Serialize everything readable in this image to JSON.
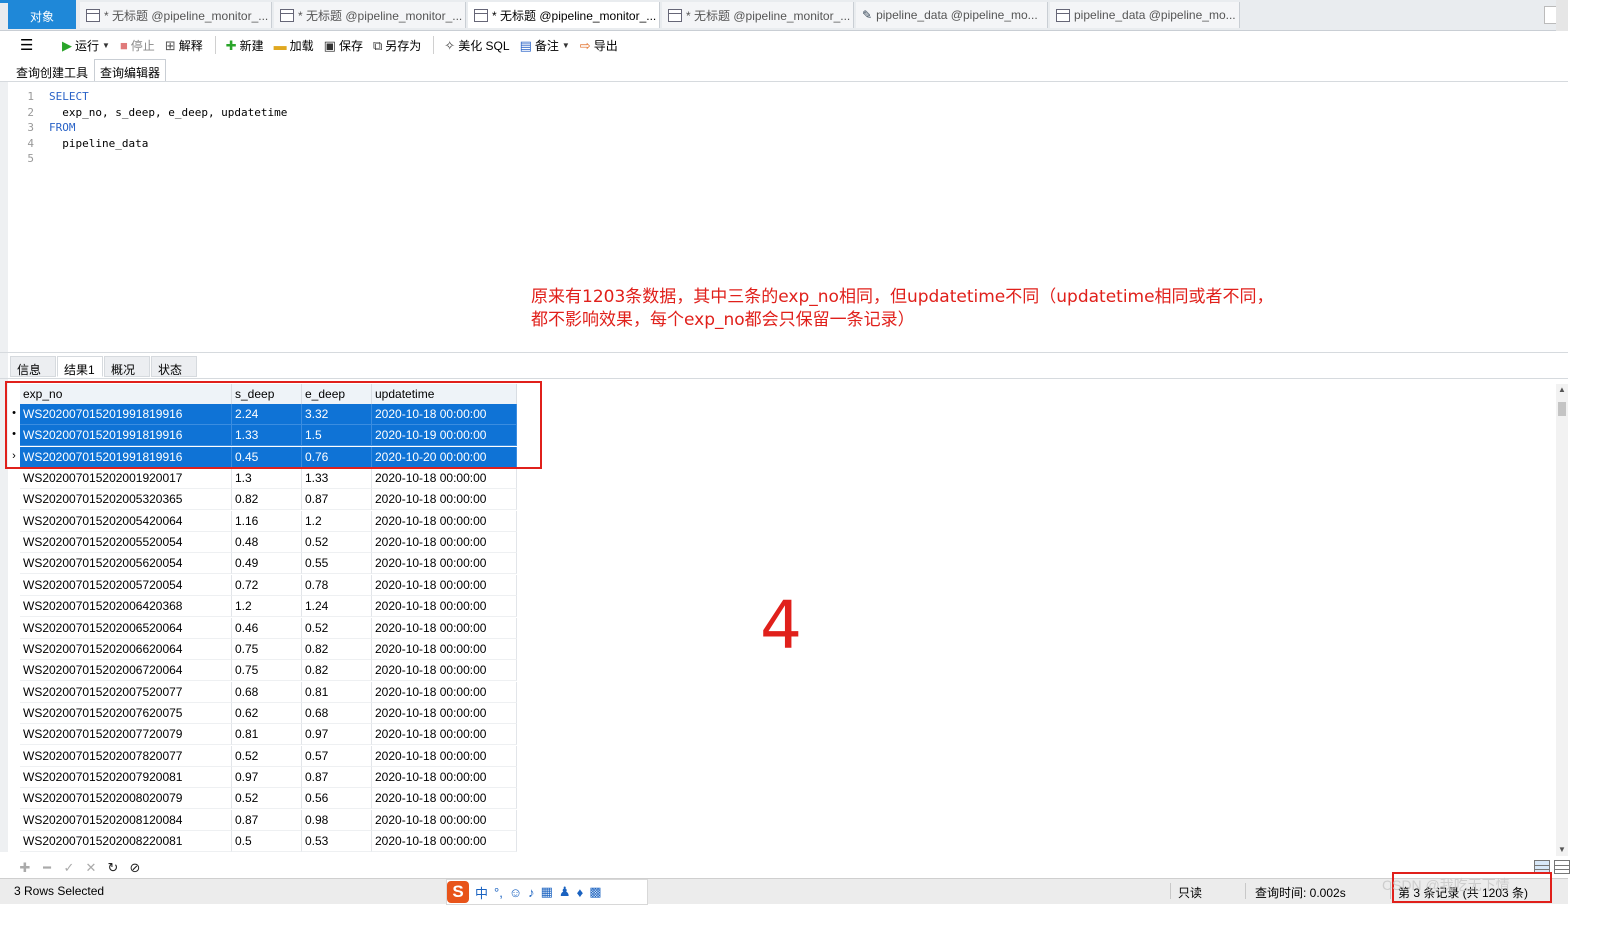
{
  "tabs": {
    "objects": "对象",
    "doc_tabs": [
      {
        "label": "* 无标题 @pipeline_monitor_...",
        "icon": "query-icon",
        "active": false
      },
      {
        "label": "* 无标题 @pipeline_monitor_...",
        "icon": "query-icon",
        "active": false
      },
      {
        "label": "* 无标题 @pipeline_monitor_...",
        "icon": "query-icon",
        "active": true
      },
      {
        "label": "* 无标题 @pipeline_monitor_...",
        "icon": "query-icon",
        "active": false
      },
      {
        "label": "pipeline_data @pipeline_mo...",
        "icon": "design-table-icon",
        "active": false
      },
      {
        "label": "pipeline_data @pipeline_mo...",
        "icon": "table-icon",
        "active": false
      }
    ]
  },
  "toolbar": {
    "run": "运行",
    "stop": "停止",
    "explain": "解释",
    "new": "新建",
    "load": "加载",
    "save": "保存",
    "save_as": "另存为",
    "beautify": "美化 SQL",
    "comment": "备注",
    "export": "导出"
  },
  "editor_tabs": {
    "builder": "查询创建工具",
    "editor": "查询编辑器"
  },
  "sql": {
    "lines": [
      {
        "n": "1",
        "kw": "SELECT",
        "text": ""
      },
      {
        "n": "2",
        "kw": "",
        "text": "  exp_no, s_deep, e_deep, updatetime"
      },
      {
        "n": "3",
        "kw": "FROM",
        "text": ""
      },
      {
        "n": "4",
        "kw": "",
        "text": "  pipeline_data"
      },
      {
        "n": "5",
        "kw": "",
        "text": ""
      }
    ]
  },
  "annotation": {
    "line1": "原来有1203条数据，其中三条的exp_no相同，但updatetime不同（updatetime相同或者不同，",
    "line2": "都不影响效果，每个exp_no都会只保留一条记录）",
    "big_number": "4"
  },
  "result_tabs": [
    "信息",
    "结果1",
    "概况",
    "状态"
  ],
  "grid": {
    "columns": [
      "exp_no",
      "s_deep",
      "e_deep",
      "updatetime"
    ],
    "rows": [
      {
        "c": [
          "WS20200701520199181991​6",
          "2.24",
          "3.32",
          "2020-10-18 00:00:00"
        ],
        "sel": true,
        "mark": "•"
      },
      {
        "c": [
          "WS202007015201991819916",
          "1.33",
          "1.5",
          "2020-10-19 00:00:00"
        ],
        "sel": true,
        "mark": "•"
      },
      {
        "c": [
          "WS202007015201991819916",
          "0.45",
          "0.76",
          "2020-10-20 00:00:00"
        ],
        "sel": true,
        "mark": "›"
      },
      {
        "c": [
          "WS202007015202001920017",
          "1.3",
          "1.33",
          "2020-10-18 00:00:00"
        ],
        "sel": false,
        "mark": ""
      },
      {
        "c": [
          "WS202007015202005320365",
          "0.82",
          "0.87",
          "2020-10-18 00:00:00"
        ],
        "sel": false,
        "mark": ""
      },
      {
        "c": [
          "WS202007015202005420064",
          "1.16",
          "1.2",
          "2020-10-18 00:00:00"
        ],
        "sel": false,
        "mark": ""
      },
      {
        "c": [
          "WS202007015202005520054",
          "0.48",
          "0.52",
          "2020-10-18 00:00:00"
        ],
        "sel": false,
        "mark": ""
      },
      {
        "c": [
          "WS202007015202005620054",
          "0.49",
          "0.55",
          "2020-10-18 00:00:00"
        ],
        "sel": false,
        "mark": ""
      },
      {
        "c": [
          "WS202007015202005720054",
          "0.72",
          "0.78",
          "2020-10-18 00:00:00"
        ],
        "sel": false,
        "mark": ""
      },
      {
        "c": [
          "WS202007015202006420368",
          "1.2",
          "1.24",
          "2020-10-18 00:00:00"
        ],
        "sel": false,
        "mark": ""
      },
      {
        "c": [
          "WS202007015202006520064",
          "0.46",
          "0.52",
          "2020-10-18 00:00:00"
        ],
        "sel": false,
        "mark": ""
      },
      {
        "c": [
          "WS202007015202006620064",
          "0.75",
          "0.82",
          "2020-10-18 00:00:00"
        ],
        "sel": false,
        "mark": ""
      },
      {
        "c": [
          "WS202007015202006720064",
          "0.75",
          "0.82",
          "2020-10-18 00:00:00"
        ],
        "sel": false,
        "mark": ""
      },
      {
        "c": [
          "WS202007015202007520077",
          "0.68",
          "0.81",
          "2020-10-18 00:00:00"
        ],
        "sel": false,
        "mark": ""
      },
      {
        "c": [
          "WS202007015202007620075",
          "0.62",
          "0.68",
          "2020-10-18 00:00:00"
        ],
        "sel": false,
        "mark": ""
      },
      {
        "c": [
          "WS202007015202007720079",
          "0.81",
          "0.97",
          "2020-10-18 00:00:00"
        ],
        "sel": false,
        "mark": ""
      },
      {
        "c": [
          "WS202007015202007820077",
          "0.52",
          "0.57",
          "2020-10-18 00:00:00"
        ],
        "sel": false,
        "mark": ""
      },
      {
        "c": [
          "WS202007015202007920081",
          "0.97",
          "0.87",
          "2020-10-18 00:00:00"
        ],
        "sel": false,
        "mark": ""
      },
      {
        "c": [
          "WS202007015202008020079",
          "0.52",
          "0.56",
          "2020-10-18 00:00:00"
        ],
        "sel": false,
        "mark": ""
      },
      {
        "c": [
          "WS202007015202008120084",
          "0.87",
          "0.98",
          "2020-10-18 00:00:00"
        ],
        "sel": false,
        "mark": ""
      },
      {
        "c": [
          "WS202007015202008220081",
          "0.5",
          "0.53",
          "2020-10-18 00:00:00"
        ],
        "sel": false,
        "mark": ""
      }
    ]
  },
  "status": {
    "selected": "3 Rows Selected",
    "readonly": "只读",
    "query_time": "查询时间: 0.002s",
    "record": "第 3 条记录 (共 1203 条)",
    "watermark": "CSDN @我吃无下情"
  },
  "colors": {
    "accent": "#1f88d8",
    "selection": "#0f73d6",
    "annotation_red": "#e0201b",
    "sql_keyword": "#2a63c7"
  }
}
